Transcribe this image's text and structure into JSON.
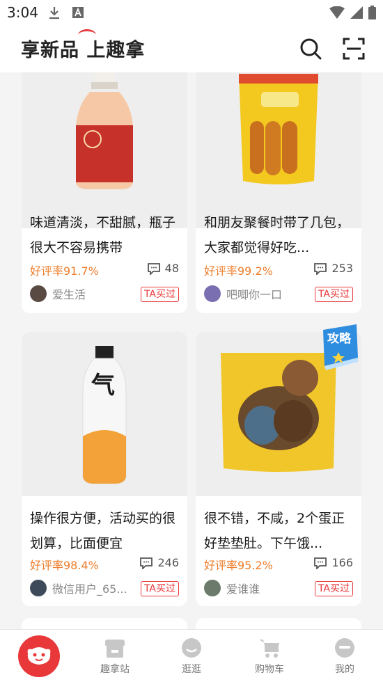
{
  "status_bar": {
    "time": "3:04"
  },
  "header": {
    "logo": "享新品 上趣拿"
  },
  "cards": [
    {
      "title": "味道清淡，不甜腻，瓶子很大不容易携带",
      "rate": "好评率91.7%",
      "comments": "48",
      "user": "爱生活",
      "bought": "TA买过"
    },
    {
      "title": "和朋友聚餐时带了几包，大家都觉得好吃...",
      "rate": "好评率99.2%",
      "comments": "253",
      "user": "吧唧你一口",
      "bought": "TA买过"
    },
    {
      "title": "操作很方便，活动买的很划算，比面便宜",
      "rate": "好评率98.4%",
      "comments": "246",
      "user": "微信用户_65...",
      "bought": "TA买过"
    },
    {
      "title": "很不错，不咸，2个蛋正好垫垫肚。下午饿...",
      "rate": "好评率95.2%",
      "comments": "166",
      "user": "爱谁谁",
      "bought": "TA买过"
    }
  ],
  "badge": {
    "label": "攻略"
  },
  "nav": {
    "items": [
      "趣拿站",
      "逛逛",
      "购物车",
      "我的"
    ]
  },
  "colors": {
    "accent": "#e8383a",
    "rate": "#ef7d2b"
  }
}
